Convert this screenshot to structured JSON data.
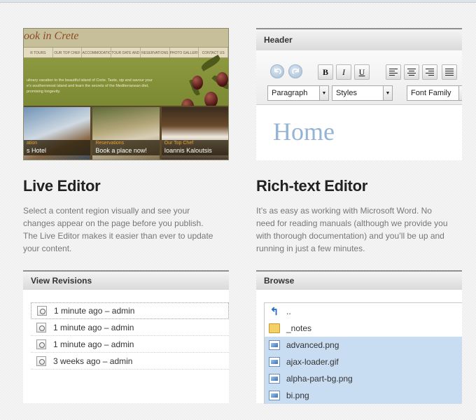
{
  "live_editor": {
    "title": "Live Editor",
    "description_lines": [
      "Select a content region visually and see your",
      "changes appear on the page before you publish.",
      "The Live Editor makes it easier than ever to update",
      "your content."
    ],
    "screenshot": {
      "logo": "ook in Crete",
      "nav": [
        "R TOURS",
        "OUR TOP CHEF",
        "ACCOMMODATION",
        "TOUR DATE AND PRICES",
        "RESERVATIONS",
        "PHOTO GALLERY",
        "CONTACT US"
      ],
      "intro_lines": [
        "ulinary vacation to the beautiful island of Crete. Taste, sip and savour your",
        "e's southernmost island and learn the secrets of the Mediterranean diet,",
        "promising longevity."
      ],
      "cards": [
        {
          "label": "ation",
          "caption": "s Hotel"
        },
        {
          "label": "Reservations",
          "caption": "Book a place now!"
        },
        {
          "label": "Our Top Chef",
          "caption": "Ioannis Kaloutsis"
        }
      ]
    }
  },
  "rich_text_editor": {
    "title": "Rich-text Editor",
    "panel_title": "Header",
    "toolbar": {
      "undo_icon": "undo-icon",
      "redo_icon": "redo-icon",
      "bold": "B",
      "italic": "I",
      "underline": "U",
      "align_icons": [
        "align-left-icon",
        "align-center-icon",
        "align-right-icon",
        "align-justify-icon"
      ],
      "format_select": "Paragraph",
      "styles_select": "Styles",
      "font_family_select": "Font Family"
    },
    "content_heading": "Home",
    "description_lines": [
      "It’s as easy as working with Microsoft Word. No",
      "need for reading manuals (although we provide you",
      "with thorough documentation) and you’ll be up and",
      "running in just a few minutes."
    ]
  },
  "view_revisions": {
    "panel_title": "View Revisions",
    "items": [
      {
        "time": "1 minute ago",
        "sep": "–",
        "user": "admin"
      },
      {
        "time": "1 minute ago",
        "sep": "–",
        "user": "admin"
      },
      {
        "time": "1 minute ago",
        "sep": "–",
        "user": "admin"
      },
      {
        "time": "3 weeks ago",
        "sep": "–",
        "user": "admin"
      }
    ]
  },
  "browse": {
    "panel_title": "Browse",
    "items": [
      {
        "name": "..",
        "icon": "up-arrow-icon",
        "selected": false
      },
      {
        "name": "_notes",
        "icon": "folder-icon",
        "selected": false
      },
      {
        "name": "advanced.png",
        "icon": "image-file-icon",
        "selected": true
      },
      {
        "name": "ajax-loader.gif",
        "icon": "image-file-icon",
        "selected": true
      },
      {
        "name": "alpha-part-bg.png",
        "icon": "image-file-icon",
        "selected": true
      },
      {
        "name": "bi.png",
        "icon": "image-file-icon",
        "selected": true
      }
    ]
  },
  "colors": {
    "selection": "#c8dcf2",
    "heading_blue": "#95b3d6",
    "site_green": "#7c8a33",
    "site_caption_orange": "#e8a033"
  }
}
